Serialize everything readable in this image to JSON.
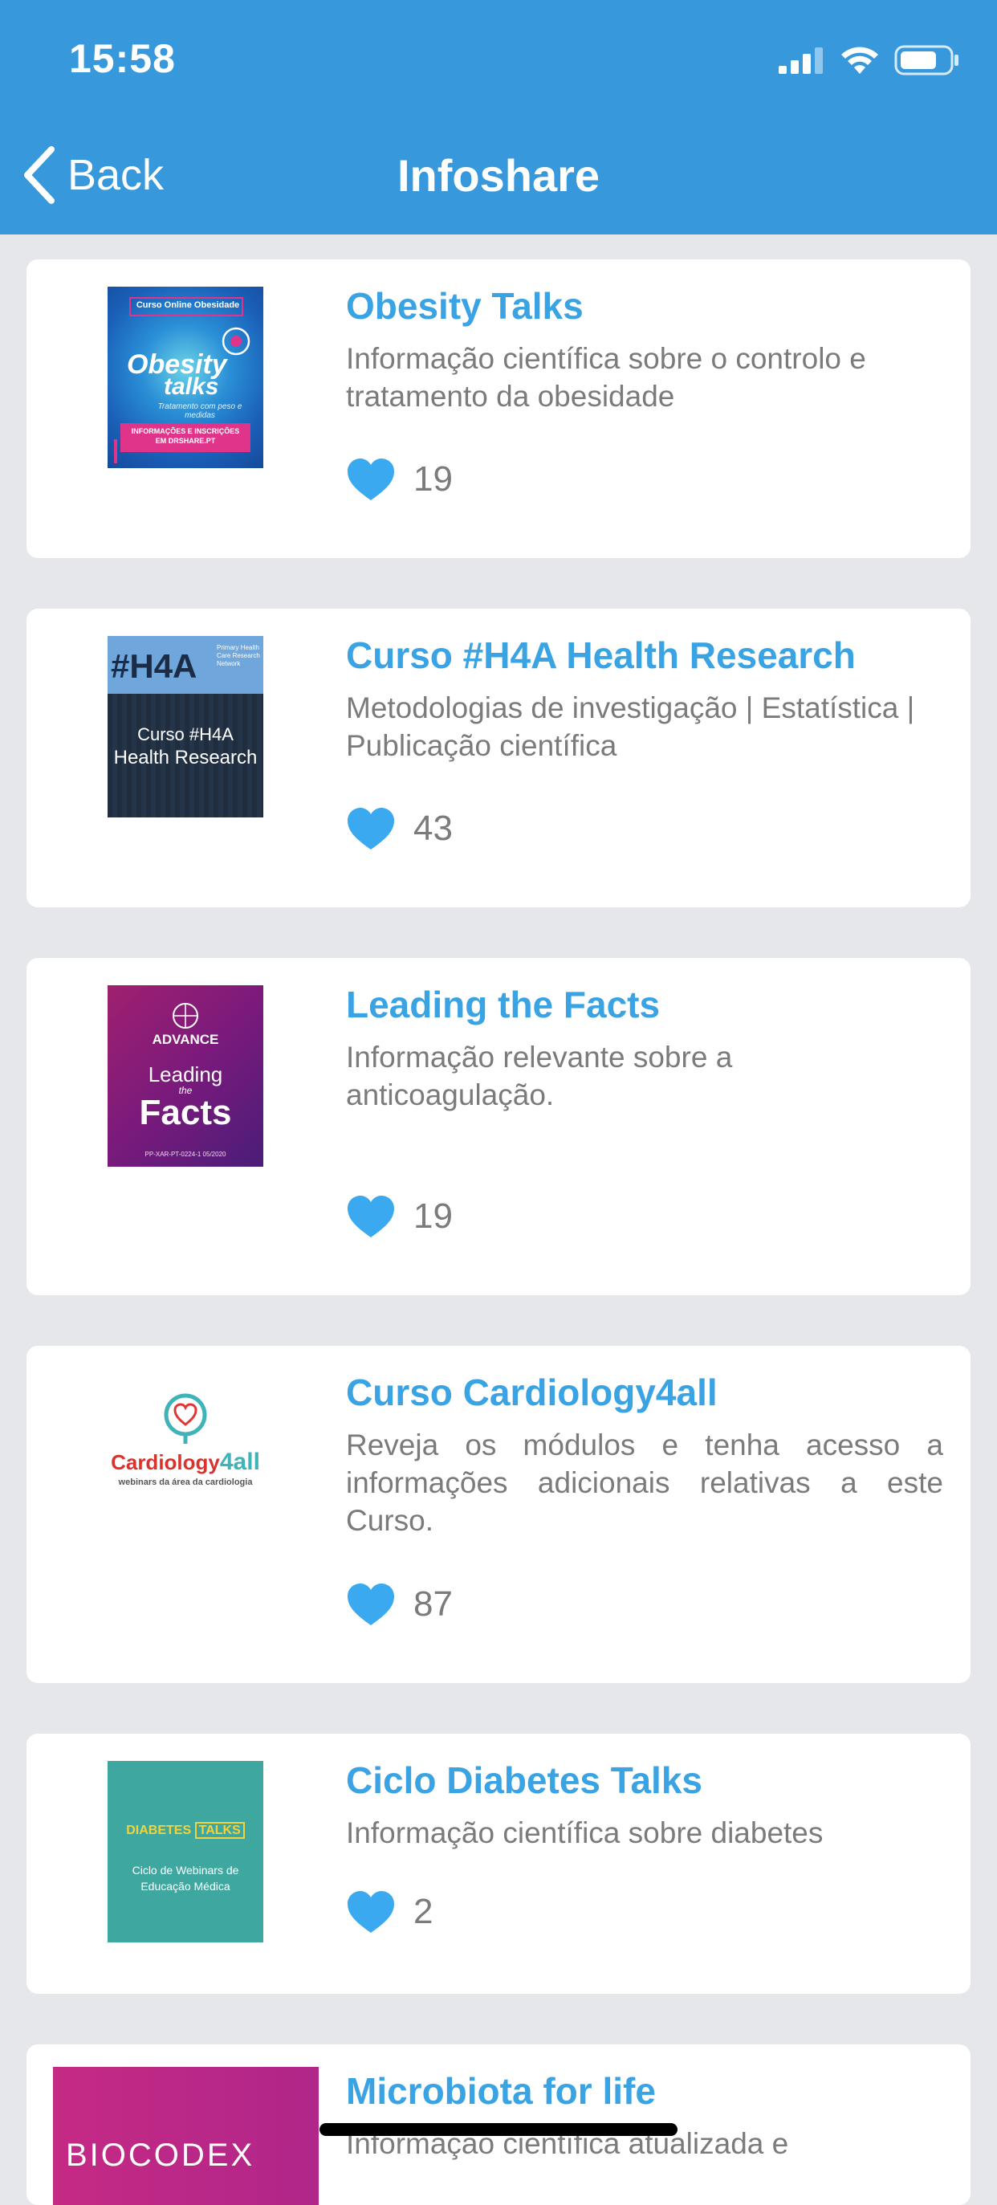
{
  "status_bar": {
    "time": "15:58"
  },
  "nav": {
    "back_label": "Back",
    "title": "Infoshare"
  },
  "items": [
    {
      "title": "Obesity Talks",
      "description": "Informação científica sobre o controlo e tratamento da obesidade",
      "likes": "19",
      "thumb": {
        "header": "Curso Online Obesidade",
        "line1": "Obesity",
        "line2": "talks",
        "subtitle": "Tratamento com peso e medidas",
        "footer": "INFORMAÇÕES E INSCRIÇÕES EM DRSHARE.PT"
      }
    },
    {
      "title": "Curso #H4A Health Research",
      "description": "Metodologias de investigação | Estatística | Publicação científica",
      "likes": "43",
      "thumb": {
        "logo": "#H4A",
        "network": "Primary Health Care Research Network",
        "line1": "Curso #H4A",
        "line2": "Health Research"
      }
    },
    {
      "title": "Leading the Facts",
      "description": "Informação relevante sobre a anticoagulação.",
      "likes": "19",
      "thumb": {
        "brand": "BAYER",
        "kicker": "ADVANCE",
        "line1": "Leading",
        "line2": "the",
        "line3": "Facts",
        "code": "PP-XAR-PT-0224-1 05/2020"
      }
    },
    {
      "title": "Curso Cardiology4all",
      "description": "Reveja os módulos e tenha acesso a informações adicionais relativas a este Curso.",
      "likes": "87",
      "thumb": {
        "word": "Cardiology",
        "num": "4all",
        "tagline": "webinars da área da cardiologia"
      }
    },
    {
      "title": "Ciclo Diabetes Talks",
      "description": "Informação científica sobre diabetes",
      "likes": "2",
      "thumb": {
        "word1": "DIABETES",
        "word2": "TALKS",
        "line1": "Ciclo de Webinars de",
        "line2": "Educação Médica"
      }
    },
    {
      "title": "Microbiota for life",
      "description": "Informação científica atualizada e",
      "thumb": {
        "brand": "BIOCODEX"
      }
    }
  ],
  "colors": {
    "accent": "#3799dc",
    "title": "#3aa3e4",
    "heart": "#3aa9ef"
  }
}
